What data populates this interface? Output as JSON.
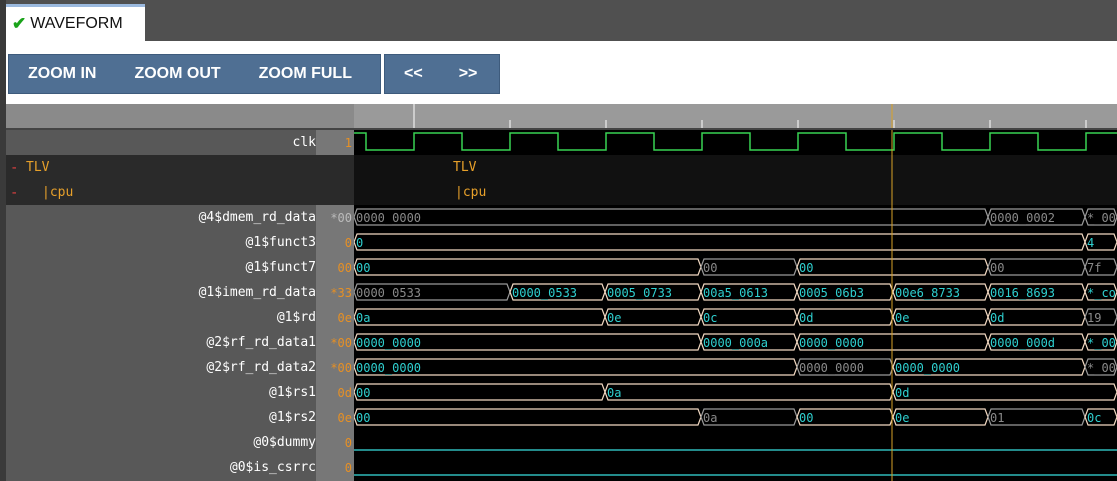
{
  "tab": {
    "label": "WAVEFORM"
  },
  "toolbar": {
    "zoom_in": "ZOOM IN",
    "zoom_out": "ZOOM OUT",
    "zoom_full": "ZOOM FULL",
    "prev": "<<",
    "next": ">>"
  },
  "colors": {
    "clk": "#39d353",
    "wave_text": "#2fd0d0",
    "wave_text_dim": "#8a8a8a",
    "bus_border": "#f2d9c2",
    "cursor": "#d9a227",
    "value_orange": "#e79024"
  },
  "clk": {
    "name": "clk",
    "value": "1"
  },
  "scopes": [
    {
      "name": "TLV",
      "wave_label": "TLV"
    },
    {
      "name": "|cpu",
      "wave_label": "|cpu"
    }
  ],
  "signals": [
    {
      "name": "@4$dmem_rd_data",
      "value": "*00",
      "dim_val": true,
      "segments": [
        {
          "label": "0000_0000",
          "dim": true
        },
        {
          "label": "0000_0002",
          "dim": true
        },
        {
          "label": "*_00",
          "dim": true
        }
      ]
    },
    {
      "name": "@1$funct3",
      "value": "0",
      "dim_val": false,
      "segments": [
        {
          "label": "0",
          "dim": false
        },
        {
          "label": "4",
          "dim": false
        }
      ]
    },
    {
      "name": "@1$funct7",
      "value": "00",
      "dim_val": false,
      "segments": [
        {
          "label": "00",
          "dim": false
        },
        {
          "label": "00",
          "dim": true
        },
        {
          "label": "00",
          "dim": false
        },
        {
          "label": "00",
          "dim": true
        },
        {
          "label": "7f",
          "dim": true
        }
      ]
    },
    {
      "name": "@1$imem_rd_data",
      "value": "*33",
      "dim_val": false,
      "segments": [
        {
          "label": "0000_0533",
          "dim": true
        },
        {
          "label": "0000_0533",
          "dim": false
        },
        {
          "label": "0005_0733",
          "dim": false
        },
        {
          "label": "00a5_0613",
          "dim": false
        },
        {
          "label": "0005_06b3",
          "dim": false
        },
        {
          "label": "00e6_8733",
          "dim": false
        },
        {
          "label": "0016_8693",
          "dim": false
        },
        {
          "label": "*_co",
          "dim": false
        }
      ]
    },
    {
      "name": "@1$rd",
      "value": "0e",
      "dim_val": false,
      "segments": [
        {
          "label": "0a",
          "dim": false
        },
        {
          "label": "0e",
          "dim": false
        },
        {
          "label": "0c",
          "dim": false
        },
        {
          "label": "0d",
          "dim": false
        },
        {
          "label": "0e",
          "dim": false
        },
        {
          "label": "0d",
          "dim": false
        },
        {
          "label": "19",
          "dim": true
        }
      ]
    },
    {
      "name": "@2$rf_rd_data1",
      "value": "*00",
      "dim_val": false,
      "segments": [
        {
          "label": "0000_0000",
          "dim": false
        },
        {
          "label": "0000_000a",
          "dim": false
        },
        {
          "label": "0000_0000",
          "dim": false
        },
        {
          "label": "0000_000d",
          "dim": false
        },
        {
          "label": "*_00",
          "dim": false
        }
      ]
    },
    {
      "name": "@2$rf_rd_data2",
      "value": "*00",
      "dim_val": false,
      "segments": [
        {
          "label": "0000_0000",
          "dim": false
        },
        {
          "label": "0000_0000",
          "dim": true
        },
        {
          "label": "0000_0000",
          "dim": false
        },
        {
          "label": "*_00",
          "dim": true
        }
      ]
    },
    {
      "name": "@1$rs1",
      "value": "0d",
      "dim_val": false,
      "segments": [
        {
          "label": "00",
          "dim": false
        },
        {
          "label": "0a",
          "dim": false
        },
        {
          "label": "0d",
          "dim": false
        }
      ]
    },
    {
      "name": "@1$rs2",
      "value": "0e",
      "dim_val": false,
      "segments": [
        {
          "label": "00",
          "dim": false
        },
        {
          "label": "0a",
          "dim": true
        },
        {
          "label": "00",
          "dim": false
        },
        {
          "label": "0e",
          "dim": false
        },
        {
          "label": "01",
          "dim": true
        },
        {
          "label": "0c",
          "dim": false
        }
      ]
    },
    {
      "name": "@0$dummy",
      "value": "0",
      "dim_val": false,
      "segments": []
    },
    {
      "name": "@0$is_csrrc",
      "value": "0",
      "dim_val": false,
      "segments": []
    }
  ]
}
